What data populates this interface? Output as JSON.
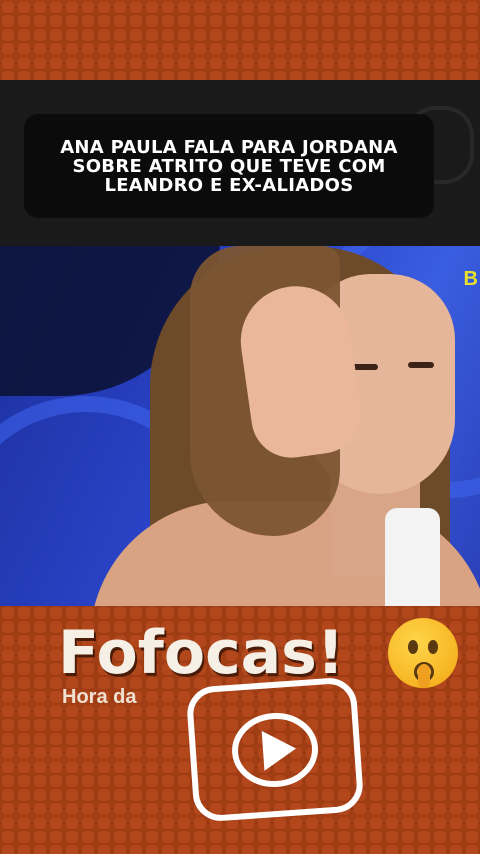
{
  "caption": {
    "text": "ANA PAULA FALA PARA JORDANA SOBRE ATRITO QUE TEVE COM LEANDRO E EX-ALIADOS"
  },
  "video": {
    "corner_logo": "B"
  },
  "branding": {
    "title": "Fofocas!",
    "subtitle": "Hora da",
    "emoji": "shushing-face-icon",
    "play_icon": "play-icon"
  },
  "colors": {
    "hex_background": "#8a3310",
    "caption_box": "#0b0b0b",
    "title_text": "#f5efe6",
    "logo_yellow": "#e8e22a"
  }
}
